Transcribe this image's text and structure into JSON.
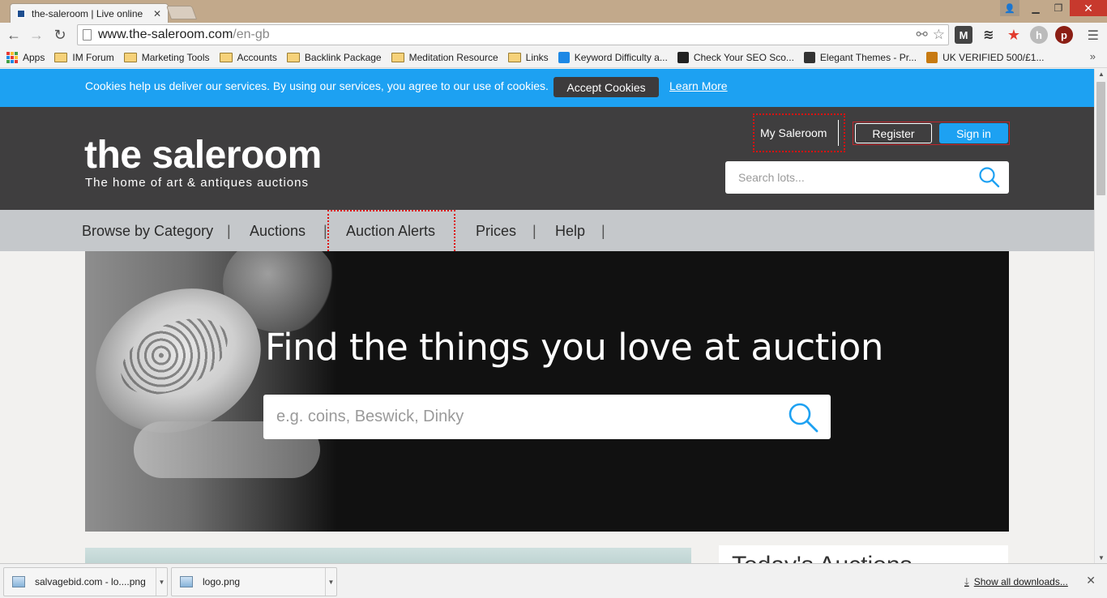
{
  "browser": {
    "tab_title": "the-saleroom | Live online",
    "url_host": "www.the-saleroom.com",
    "url_path": "/en-gb",
    "bookmarks": [
      {
        "label": "Apps",
        "kind": "apps"
      },
      {
        "label": "IM Forum",
        "kind": "folder"
      },
      {
        "label": "Marketing Tools",
        "kind": "folder"
      },
      {
        "label": "Accounts",
        "kind": "folder"
      },
      {
        "label": "Backlink Package",
        "kind": "folder"
      },
      {
        "label": "Meditation Resource",
        "kind": "folder"
      },
      {
        "label": "Links",
        "kind": "folder"
      },
      {
        "label": "Keyword Difficulty a...",
        "kind": "site",
        "color": "#1e88e5"
      },
      {
        "label": "Check Your SEO Sco...",
        "kind": "site",
        "color": "#222222"
      },
      {
        "label": "Elegant Themes - Pr...",
        "kind": "site",
        "color": "#333333"
      },
      {
        "label": "UK VERIFIED 500/£1...",
        "kind": "site",
        "color": "#c77a12"
      }
    ],
    "bookmarks_overflow": "»"
  },
  "cookie_bar": {
    "text": "Cookies help us deliver our services. By using our services, you agree to our use of cookies.",
    "accept_label": "Accept Cookies",
    "learn_more_label": "Learn More"
  },
  "header": {
    "logo_name": "the saleroom",
    "logo_tagline": "The home of art & antiques auctions",
    "my_saleroom_label": "My Saleroom",
    "register_label": "Register",
    "signin_label": "Sign in",
    "search_placeholder": "Search lots..."
  },
  "nav": {
    "items": [
      "Browse by Category",
      "Auctions",
      "Auction Alerts",
      "Prices",
      "Help"
    ]
  },
  "hero": {
    "title": "Find the things you love at auction",
    "search_placeholder": "e.g. coins, Beswick, Dinky"
  },
  "below": {
    "right_title": "Today's Auctions"
  },
  "downloads": {
    "items": [
      "salvagebid.com - lo....png",
      "logo.png"
    ],
    "show_all_label": "Show all downloads..."
  },
  "colors": {
    "brand_blue": "#1da1f2",
    "header_dark": "#3f3e3f",
    "nav_grey": "#c5c8cb",
    "highlight_red": "#dd1111"
  }
}
